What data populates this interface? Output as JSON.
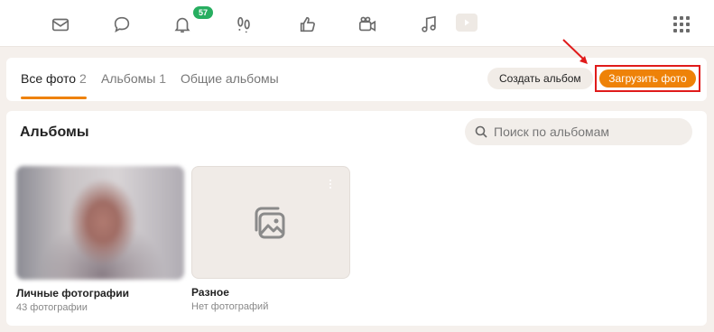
{
  "topnav": {
    "icons": [
      "mail-icon",
      "chat-icon",
      "bell-icon",
      "footprints-icon",
      "thumbs-up-icon",
      "video-camera-icon",
      "music-note-icon",
      "video-play-icon",
      "apps-grid-icon"
    ],
    "notifications_badge": "57"
  },
  "tabs": {
    "all_photos_label": "Все фото",
    "all_photos_count": "2",
    "albums_label": "Альбомы",
    "albums_count": "1",
    "shared_albums_label": "Общие альбомы"
  },
  "actions": {
    "create_album": "Создать альбом",
    "upload_photo": "Загрузить фото"
  },
  "albums_section": {
    "title": "Альбомы",
    "search_placeholder": "Поиск по альбомам",
    "albums": [
      {
        "name": "Личные фотографии",
        "count": "43 фотографии"
      },
      {
        "name": "Разное",
        "count": "Нет фотографий"
      }
    ]
  },
  "colors": {
    "accent": "#ee8208",
    "badge": "#27ae60",
    "highlight_box": "#e01b1b",
    "page_bg": "#f5f0ec"
  }
}
